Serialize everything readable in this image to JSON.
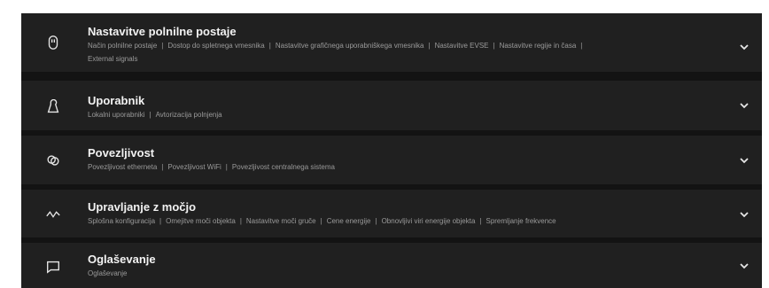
{
  "sections": [
    {
      "title": "Nastavitve polnilne postaje",
      "icon": "charger-plug-icon",
      "links_line1": [
        "Način polnilne postaje",
        "Dostop do spletnega vmesnika",
        "Nastavitve grafičnega uporabniškega vmesnika",
        "Nastavitve EVSE",
        "Nastavitve regije in časa"
      ],
      "links_line2": [
        "External signals"
      ]
    },
    {
      "title": "Uporabnik",
      "icon": "user-icon",
      "links_line1": [
        "Lokalni uporabniki",
        "Avtorizacija polnjenja"
      ]
    },
    {
      "title": "Povezljivost",
      "icon": "link-icon",
      "links_line1": [
        "Povezljivost etherneta",
        "Povezljivost WiFi",
        "Povezljivost centralnega sistema"
      ]
    },
    {
      "title": "Upravljanje z močjo",
      "icon": "power-wave-icon",
      "links_line1": [
        "Splošna konfiguracija",
        "Omejitve moči objekta",
        "Nastavitve moči gruče",
        "Cene energije",
        "Obnovljivi viri energije objekta",
        "Spremljanje frekvence"
      ]
    },
    {
      "title": "Oglaševanje",
      "icon": "message-icon",
      "links_line1": [
        "Oglaševanje"
      ]
    }
  ],
  "colors": {
    "row_background": "#202020",
    "panel_background": "#131313",
    "title_text": "#f2f2f2",
    "link_text": "#9a9a9a"
  }
}
